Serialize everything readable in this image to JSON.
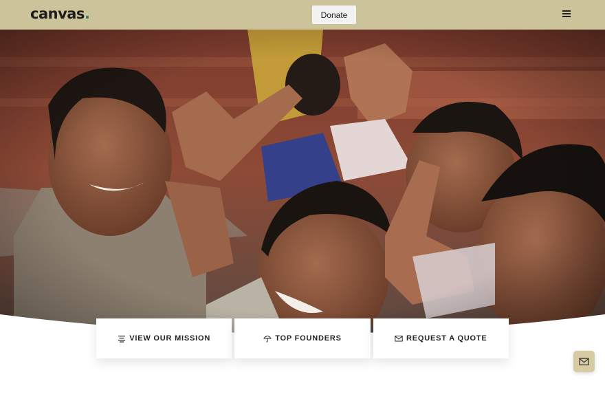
{
  "header": {
    "logo_text": "canvas",
    "logo_dot": ".",
    "donate_label": "Donate"
  },
  "hero": {
    "image_subject": "group of smiling children making peace signs"
  },
  "cards": [
    {
      "label": "VIEW OUR MISSION",
      "icon": "align-lines-icon"
    },
    {
      "label": "TOP FOUNDERS",
      "icon": "umbrella-icon"
    },
    {
      "label": "REQUEST A QUOTE",
      "icon": "envelope-icon"
    }
  ],
  "colors": {
    "header_bg": "#cdc39b",
    "fab_bg": "#d7cba4",
    "logo_dot": "#2f7f6f"
  },
  "fab": {
    "icon": "envelope-icon"
  }
}
